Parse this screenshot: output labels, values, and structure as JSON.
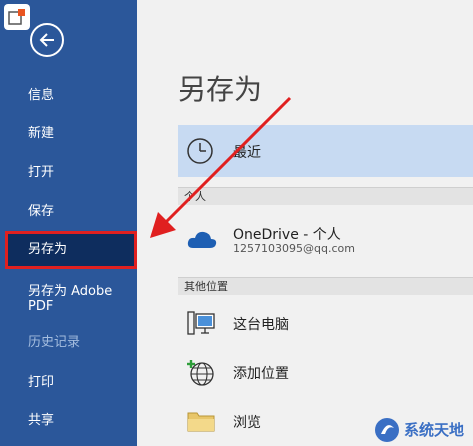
{
  "sidebar": {
    "items": [
      {
        "label": "信息"
      },
      {
        "label": "新建"
      },
      {
        "label": "打开"
      },
      {
        "label": "保存"
      },
      {
        "label": "另存为"
      },
      {
        "label": "另存为 Adobe\nPDF"
      },
      {
        "label": "历史记录"
      },
      {
        "label": "打印"
      },
      {
        "label": "共享"
      }
    ]
  },
  "main": {
    "title": "另存为",
    "recent_label": "最近",
    "sections": [
      {
        "header": "个人"
      },
      {
        "header": "其他位置"
      }
    ],
    "onedrive": {
      "name": "OneDrive - 个人",
      "account": "1257103095@qq.com"
    },
    "locations": [
      {
        "label": "这台电脑"
      },
      {
        "label": "添加位置"
      },
      {
        "label": "浏览"
      }
    ]
  },
  "watermark": {
    "text": "系统天地"
  },
  "colors": {
    "sidebar": "#2b579a",
    "selected": "#002050",
    "recent_bg": "#c7daf2",
    "annotation": "#e02020"
  }
}
